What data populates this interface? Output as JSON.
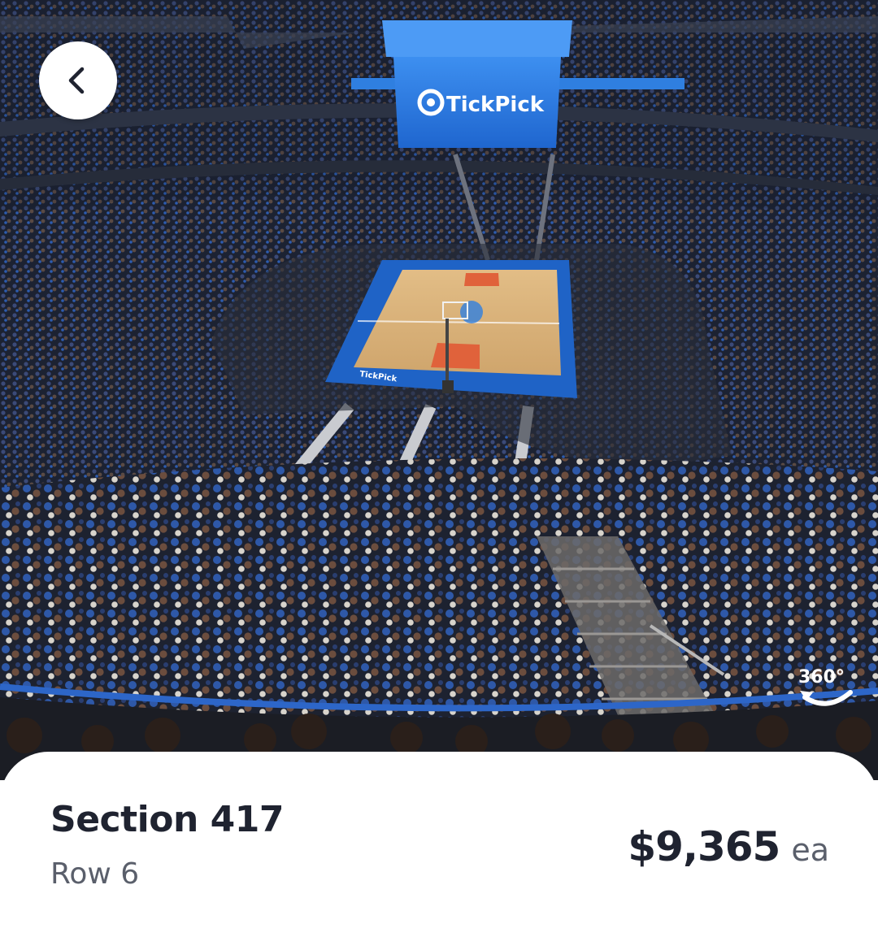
{
  "venue_view": {
    "scoreboard_brand": "TickPick",
    "court_branding": "TickPick",
    "view_360_label": "360°"
  },
  "listing": {
    "section": "Section 417",
    "row": "Row 6",
    "price": "$9,365",
    "price_unit": "ea"
  },
  "icons": {
    "back": "chevron-left-icon",
    "view_360": "rotate-360-icon",
    "brand": "tickpick-logo-icon"
  },
  "colors": {
    "scoreboard_blue": "#2f7fe0",
    "court_blue": "#1f63c6",
    "court_wood": "#d9b27a",
    "paint_orange": "#e0623b",
    "text_dark": "#1f2330",
    "text_muted": "#5a5f6b"
  }
}
